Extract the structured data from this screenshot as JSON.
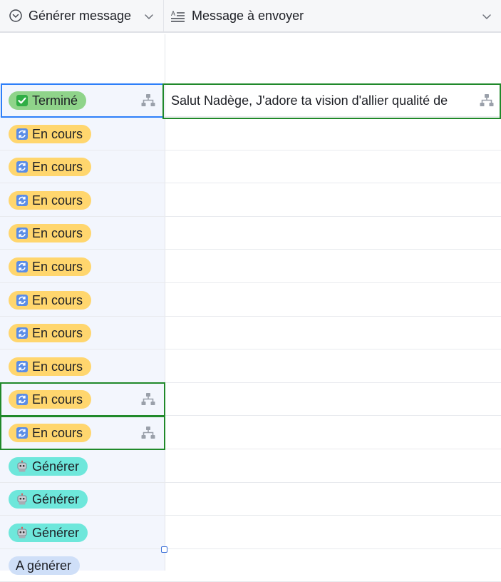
{
  "header": {
    "col1": {
      "label": "Générer message",
      "icon": "circle-chevron-down-icon"
    },
    "col2": {
      "label": "Message à envoyer",
      "icon": "long-text-icon"
    }
  },
  "rows": [
    {
      "status": "Terminé",
      "emoji": "check-box-icon",
      "style": "done",
      "message": "Salut Nadège, J'adore ta vision d'allier qualité de"
    },
    {
      "status": "En cours",
      "emoji": "refresh-icon",
      "style": "prog"
    },
    {
      "status": "En cours",
      "emoji": "refresh-icon",
      "style": "prog"
    },
    {
      "status": "En cours",
      "emoji": "refresh-icon",
      "style": "prog"
    },
    {
      "status": "En cours",
      "emoji": "refresh-icon",
      "style": "prog"
    },
    {
      "status": "En cours",
      "emoji": "refresh-icon",
      "style": "prog"
    },
    {
      "status": "En cours",
      "emoji": "refresh-icon",
      "style": "prog"
    },
    {
      "status": "En cours",
      "emoji": "refresh-icon",
      "style": "prog"
    },
    {
      "status": "En cours",
      "emoji": "refresh-icon",
      "style": "prog"
    },
    {
      "status": "En cours",
      "emoji": "refresh-icon",
      "style": "prog"
    },
    {
      "status": "En cours",
      "emoji": "refresh-icon",
      "style": "prog"
    },
    {
      "status": "Générer",
      "emoji": "robot-icon",
      "style": "gen"
    },
    {
      "status": "Générer",
      "emoji": "robot-icon",
      "style": "gen"
    },
    {
      "status": "Générer",
      "emoji": "robot-icon",
      "style": "gen"
    },
    {
      "status": "A générer",
      "emoji": "",
      "style": "todo"
    }
  ],
  "colors": {
    "selection": "#2d7ff9",
    "dependency": "#20892a",
    "done": "#8fd48a",
    "in_progress": "#ffd66e",
    "generate": "#6ee7db",
    "to_generate": "#cfdff8"
  }
}
